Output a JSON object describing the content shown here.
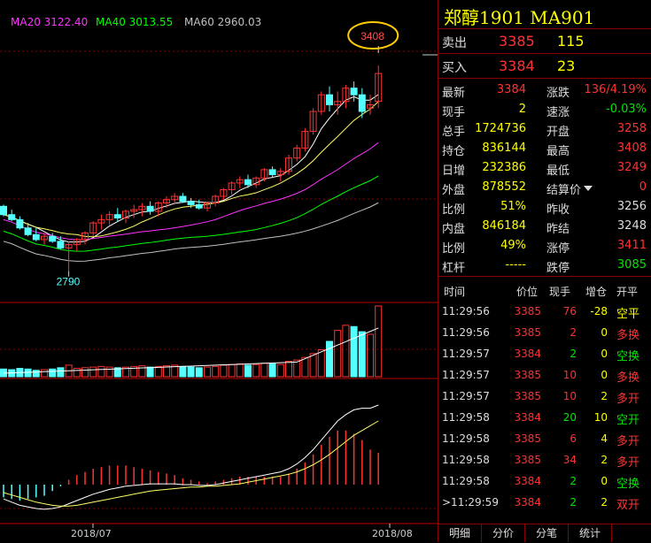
{
  "ma_legend": {
    "ma20": "MA20 3122.40",
    "ma40": "MA40 3013.55",
    "ma60": "MA60 2960.03",
    "colors": {
      "ma20": "#ff33ff",
      "ma40": "#00ff00",
      "ma60": "#c0c0c0"
    }
  },
  "chart": {
    "high_marker": "3408",
    "low_marker": "2790",
    "dates": [
      "2018/07",
      "2018/08"
    ]
  },
  "chart_data": {
    "type": "candlestick",
    "price_range": [
      2760,
      3440
    ],
    "ohlc": [
      [
        2985,
        2990,
        2955,
        2960
      ],
      [
        2960,
        2975,
        2940,
        2945
      ],
      [
        2945,
        2955,
        2915,
        2920
      ],
      [
        2920,
        2935,
        2895,
        2900
      ],
      [
        2900,
        2920,
        2880,
        2885
      ],
      [
        2885,
        2905,
        2870,
        2895
      ],
      [
        2895,
        2905,
        2875,
        2880
      ],
      [
        2880,
        2895,
        2855,
        2860
      ],
      [
        2860,
        2880,
        2790,
        2870
      ],
      [
        2870,
        2890,
        2850,
        2885
      ],
      [
        2885,
        2910,
        2870,
        2905
      ],
      [
        2905,
        2940,
        2895,
        2935
      ],
      [
        2935,
        2960,
        2915,
        2945
      ],
      [
        2945,
        2970,
        2930,
        2960
      ],
      [
        2960,
        2980,
        2940,
        2950
      ],
      [
        2950,
        2975,
        2935,
        2970
      ],
      [
        2970,
        2990,
        2950,
        2975
      ],
      [
        2975,
        2995,
        2955,
        2985
      ],
      [
        2985,
        3000,
        2960,
        2970
      ],
      [
        2970,
        3000,
        2955,
        2995
      ],
      [
        2995,
        3015,
        2980,
        3005
      ],
      [
        3005,
        3025,
        2990,
        3015
      ],
      [
        3015,
        3025,
        2995,
        3000
      ],
      [
        3000,
        3010,
        2980,
        2990
      ],
      [
        2990,
        3005,
        2975,
        2980
      ],
      [
        2980,
        3000,
        2970,
        2995
      ],
      [
        2995,
        3020,
        2985,
        3015
      ],
      [
        3015,
        3040,
        3005,
        3035
      ],
      [
        3035,
        3060,
        3020,
        3055
      ],
      [
        3055,
        3075,
        3040,
        3065
      ],
      [
        3065,
        3080,
        3040,
        3050
      ],
      [
        3050,
        3075,
        3040,
        3070
      ],
      [
        3070,
        3100,
        3060,
        3095
      ],
      [
        3095,
        3105,
        3070,
        3080
      ],
      [
        3080,
        3100,
        3060,
        3090
      ],
      [
        3090,
        3140,
        3080,
        3130
      ],
      [
        3130,
        3170,
        3120,
        3160
      ],
      [
        3160,
        3220,
        3150,
        3210
      ],
      [
        3210,
        3280,
        3200,
        3270
      ],
      [
        3270,
        3330,
        3260,
        3320
      ],
      [
        3320,
        3345,
        3270,
        3290
      ],
      [
        3290,
        3330,
        3260,
        3300
      ],
      [
        3300,
        3350,
        3280,
        3340
      ],
      [
        3340,
        3360,
        3300,
        3320
      ],
      [
        3320,
        3340,
        3250,
        3270
      ],
      [
        3280,
        3320,
        3260,
        3290
      ],
      [
        3300,
        3408,
        3280,
        3384
      ]
    ],
    "volume": [
      12,
      11,
      13,
      12,
      10,
      11,
      12,
      14,
      18,
      13,
      14,
      15,
      16,
      15,
      14,
      15,
      16,
      17,
      15,
      16,
      17,
      18,
      16,
      15,
      14,
      15,
      16,
      18,
      19,
      20,
      18,
      19,
      21,
      20,
      19,
      24,
      26,
      30,
      36,
      42,
      55,
      72,
      80,
      78,
      70,
      66,
      110
    ],
    "volume_cyan": [
      9,
      11,
      14,
      17,
      20,
      22,
      25,
      33,
      40,
      42,
      45
    ],
    "macd_dif": [
      -18,
      -22,
      -26,
      -28,
      -30,
      -31,
      -30,
      -28,
      -24,
      -20,
      -16,
      -12,
      -9,
      -6,
      -4,
      -2,
      -1,
      0,
      1,
      1,
      1,
      1,
      0,
      0,
      -1,
      -1,
      0,
      2,
      4,
      6,
      8,
      10,
      12,
      14,
      16,
      20,
      26,
      34,
      44,
      56,
      68,
      80,
      88,
      94,
      96,
      96,
      100
    ],
    "macd_dea": [
      -10,
      -13,
      -16,
      -19,
      -22,
      -24,
      -26,
      -27,
      -27,
      -26,
      -24,
      -22,
      -20,
      -18,
      -16,
      -14,
      -12,
      -10,
      -8,
      -7,
      -6,
      -5,
      -4,
      -3,
      -3,
      -2,
      -2,
      -1,
      0,
      1,
      3,
      5,
      7,
      9,
      11,
      13,
      16,
      20,
      25,
      31,
      38,
      46,
      54,
      62,
      68,
      74,
      80
    ],
    "macd_bars": [
      -8,
      -9,
      -10,
      -9,
      -8,
      -7,
      -4,
      -1,
      3,
      6,
      8,
      10,
      11,
      12,
      12,
      12,
      11,
      10,
      9,
      8,
      7,
      6,
      4,
      3,
      2,
      1,
      2,
      3,
      4,
      5,
      5,
      5,
      5,
      5,
      5,
      7,
      10,
      14,
      19,
      25,
      30,
      34,
      34,
      32,
      28,
      22,
      20
    ]
  },
  "quote": {
    "title": "郑醇1901  MA901",
    "sell": {
      "label": "卖出",
      "price": "3385",
      "vol": "115"
    },
    "buy": {
      "label": "买入",
      "price": "3384",
      "vol": "23"
    },
    "left": [
      {
        "label": "最新",
        "value": "3384",
        "color": "red"
      },
      {
        "label": "现手",
        "value": "2",
        "color": "yellow"
      },
      {
        "label": "总手",
        "value": "1724736",
        "color": "yellow"
      },
      {
        "label": "持仓",
        "value": "836144",
        "color": "yellow"
      },
      {
        "label": "日增",
        "value": "232386",
        "color": "yellow"
      },
      {
        "label": "外盘",
        "value": "878552",
        "color": "yellow"
      },
      {
        "label": "比例",
        "value": "51%",
        "color": "yellow"
      },
      {
        "label": "内盘",
        "value": "846184",
        "color": "yellow"
      },
      {
        "label": "比例",
        "value": "49%",
        "color": "yellow"
      },
      {
        "label": "杠杆",
        "value": "-----",
        "color": "yellow"
      }
    ],
    "right": [
      {
        "label": "涨跌",
        "value": "136/4.19%",
        "color": "red"
      },
      {
        "label": "速涨",
        "value": "-0.03%",
        "color": "green"
      },
      {
        "label": "开盘",
        "value": "3258",
        "color": "red"
      },
      {
        "label": "最高",
        "value": "3408",
        "color": "red"
      },
      {
        "label": "最低",
        "value": "3249",
        "color": "red"
      },
      {
        "label": "结算价",
        "value": "0",
        "color": "red"
      },
      {
        "label": "昨收",
        "value": "3256",
        "color": "white"
      },
      {
        "label": "昨结",
        "value": "3248",
        "color": "white"
      },
      {
        "label": "涨停",
        "value": "3411",
        "color": "red"
      },
      {
        "label": "跌停",
        "value": "3085",
        "color": "green"
      }
    ]
  },
  "trades": {
    "headers": {
      "time": "时间",
      "price": "价位",
      "hand": "现手",
      "pos": "增仓",
      "type": "开平"
    },
    "rows": [
      {
        "time": "11:29:56",
        "price": "3385",
        "hand": "76",
        "pos": "-28",
        "type": "空平",
        "hc": "red",
        "pc": "yellow",
        "tc": "yellow"
      },
      {
        "time": "11:29:56",
        "price": "3385",
        "hand": "2",
        "pos": "0",
        "type": "多换",
        "hc": "red",
        "pc": "yellow",
        "tc": "red"
      },
      {
        "time": "11:29:57",
        "price": "3384",
        "hand": "2",
        "pos": "0",
        "type": "空换",
        "hc": "green",
        "pc": "yellow",
        "tc": "green"
      },
      {
        "time": "11:29:57",
        "price": "3385",
        "hand": "10",
        "pos": "0",
        "type": "多换",
        "hc": "red",
        "pc": "yellow",
        "tc": "red"
      },
      {
        "time": "11:29:57",
        "price": "3385",
        "hand": "10",
        "pos": "2",
        "type": "多开",
        "hc": "red",
        "pc": "yellow",
        "tc": "red"
      },
      {
        "time": "11:29:58",
        "price": "3384",
        "hand": "20",
        "pos": "10",
        "type": "空开",
        "hc": "green",
        "pc": "yellow",
        "tc": "green"
      },
      {
        "time": "11:29:58",
        "price": "3385",
        "hand": "6",
        "pos": "4",
        "type": "多开",
        "hc": "red",
        "pc": "yellow",
        "tc": "red"
      },
      {
        "time": "11:29:58",
        "price": "3385",
        "hand": "34",
        "pos": "2",
        "type": "多开",
        "hc": "red",
        "pc": "yellow",
        "tc": "red"
      },
      {
        "time": "11:29:58",
        "price": "3384",
        "hand": "2",
        "pos": "0",
        "type": "空换",
        "hc": "green",
        "pc": "yellow",
        "tc": "green"
      },
      {
        "time": ">11:29:59",
        "price": "3384",
        "hand": "2",
        "pos": "2",
        "type": "双开",
        "hc": "green",
        "pc": "yellow",
        "tc": "red"
      }
    ]
  },
  "tabs": [
    "明细",
    "分价",
    "分笔",
    "统计"
  ]
}
